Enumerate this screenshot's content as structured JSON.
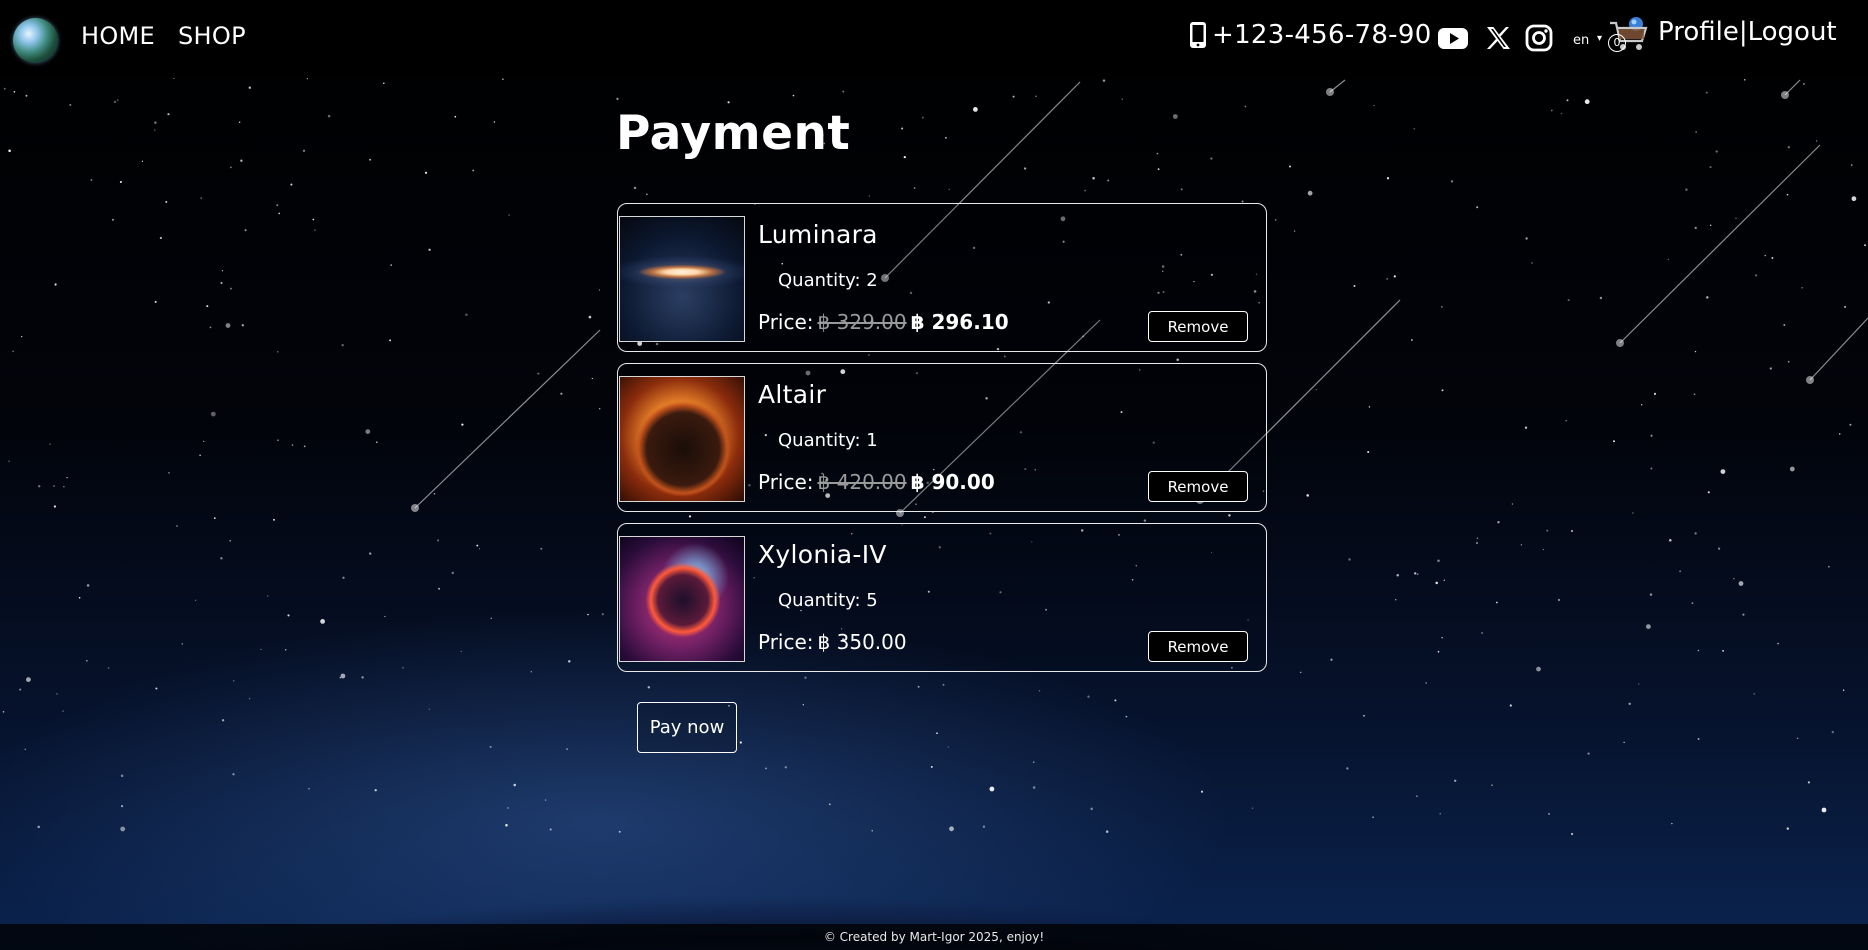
{
  "nav": {
    "home_label": "HOME",
    "shop_label": "SHOP",
    "phone": "+123-456-78-90",
    "language": "en",
    "cart_count": "0",
    "profile_label": "Profile",
    "separator": "|",
    "logout_label": "Logout"
  },
  "page": {
    "title": "Payment"
  },
  "cart_items": [
    {
      "name": "Luminara",
      "quantity_text": "Quantity: 2",
      "price_label": "Price:",
      "old_price": "฿ 329.00",
      "new_price": "฿ 296.10",
      "remove_label": "Remove"
    },
    {
      "name": "Altair",
      "quantity_text": "Quantity: 1",
      "price_label": "Price:",
      "old_price": "฿ 420.00",
      "new_price": "฿ 90.00",
      "remove_label": "Remove"
    },
    {
      "name": "Xylonia-IV",
      "quantity_text": "Quantity: 5",
      "price_label": "Price:",
      "price": "฿ 350.00",
      "remove_label": "Remove"
    }
  ],
  "pay_button_label": "Pay now",
  "footer": {
    "text": "© Created by Mart-Igor 2025, enjoy!"
  },
  "icons": {
    "logo": "earth-logo",
    "phone": "phone-icon",
    "youtube": "youtube-icon",
    "x": "x-icon",
    "instagram": "instagram-icon",
    "cart": "cart-icon"
  }
}
